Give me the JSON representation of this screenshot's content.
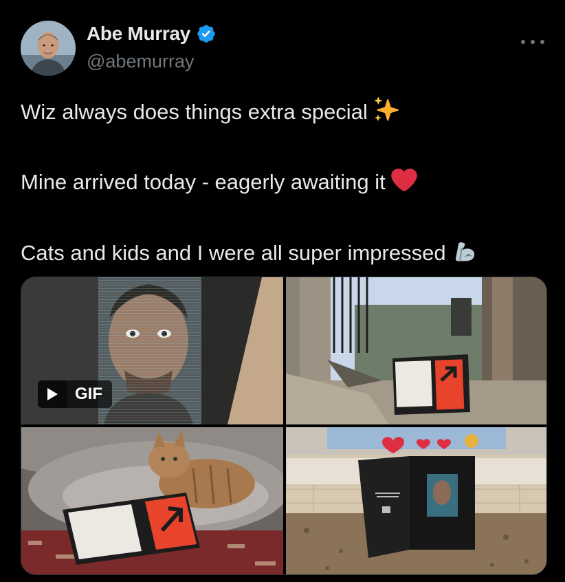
{
  "author": {
    "display_name": "Abe Murray",
    "handle": "@abemurray",
    "verified": true,
    "avatar_icon": "profile-photo"
  },
  "tweet": {
    "lines": [
      {
        "text": "Wiz always does things extra special",
        "emoji": "sparkles-icon"
      },
      {
        "text": "Mine arrived today - eagerly awaiting it",
        "emoji": "red-heart-icon"
      },
      {
        "text": "Cats and kids and I were all super impressed",
        "emoji": "mechanical-arm-icon"
      }
    ]
  },
  "media": {
    "gif_label": "GIF",
    "items": [
      {
        "kind": "gif",
        "depicts": "portrait-display"
      },
      {
        "kind": "photo",
        "depicts": "box-outdoors"
      },
      {
        "kind": "photo",
        "depicts": "cat-with-box"
      },
      {
        "kind": "photo",
        "depicts": "open-box-kitchen"
      }
    ]
  },
  "colors": {
    "background": "#000000",
    "text": "#e7e9ea",
    "muted": "#71767b",
    "verified_blue": "#1d9bf0",
    "box_orange": "#e8432b",
    "heart_red": "#dd2e44"
  }
}
